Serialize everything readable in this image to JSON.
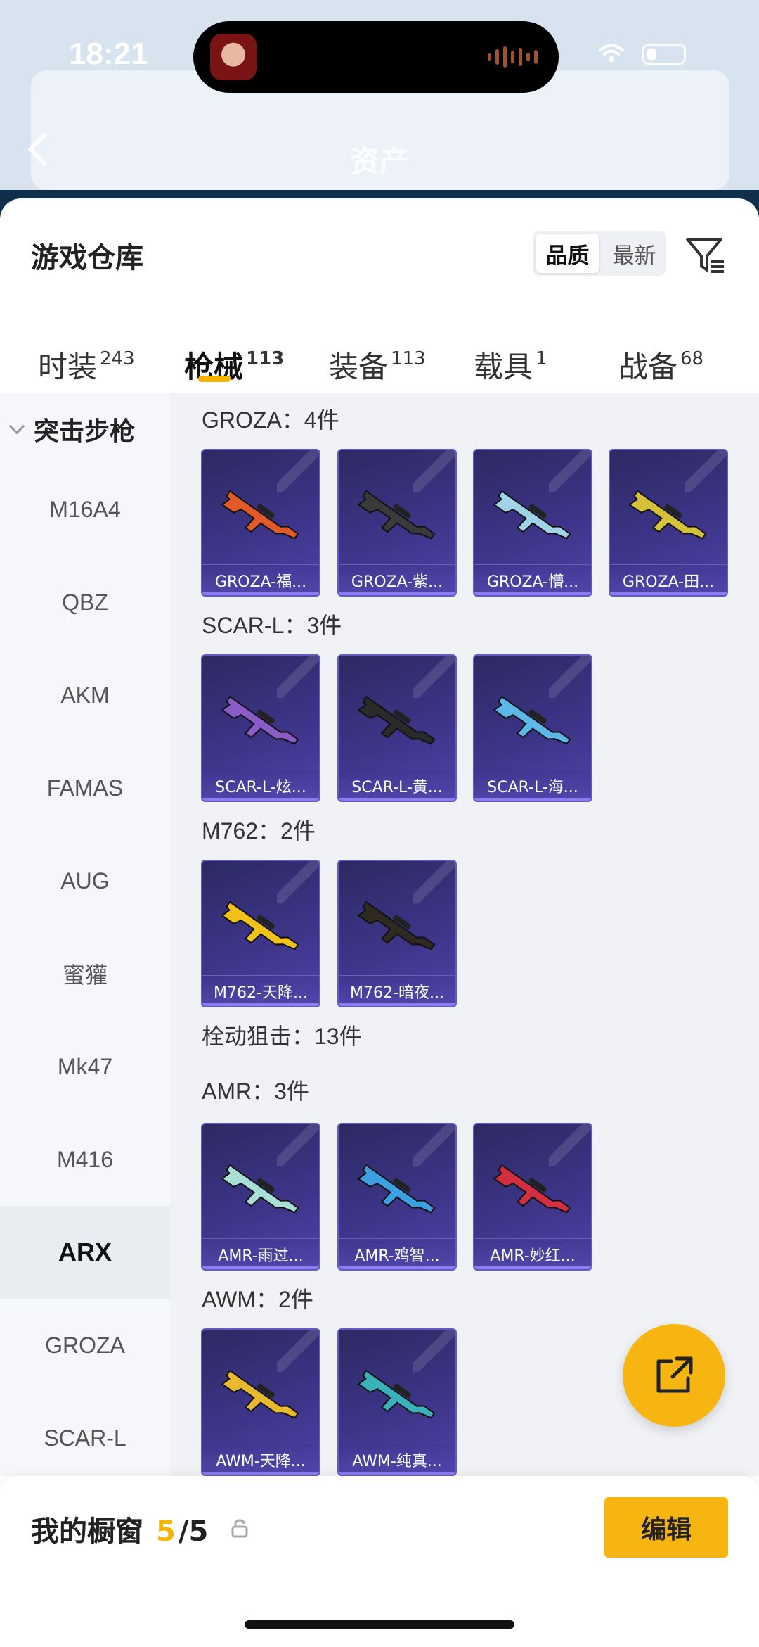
{
  "status_bar": {
    "time": "18:21"
  },
  "background_screen": {
    "title": "资产"
  },
  "sheet": {
    "title": "游戏仓库",
    "sort": {
      "options": [
        "品质",
        "最新"
      ],
      "selected": "品质"
    },
    "tabs": [
      {
        "label": "时装",
        "count": "243"
      },
      {
        "label": "枪械",
        "count": "113",
        "active": true
      },
      {
        "label": "装备",
        "count": "113"
      },
      {
        "label": "载具",
        "count": "1"
      },
      {
        "label": "战备",
        "count": "68"
      }
    ]
  },
  "sidebar": {
    "group": "突击步枪",
    "items": [
      "M16A4",
      "QBZ",
      "AKM",
      "FAMAS",
      "AUG",
      "蜜獾",
      "Mk47",
      "M416",
      "ARX",
      "GROZA",
      "SCAR-L"
    ],
    "selected": "ARX"
  },
  "sections": [
    {
      "title": "GROZA：4件",
      "items": [
        "GROZA-福...",
        "GROZA-紫...",
        "GROZA-懵...",
        "GROZA-田..."
      ]
    },
    {
      "title": "SCAR-L：3件",
      "items": [
        "SCAR-L-炫...",
        "SCAR-L-黄...",
        "SCAR-L-海..."
      ]
    },
    {
      "title": "M762：2件",
      "items": [
        "M762-天降...",
        "M762-暗夜..."
      ]
    },
    {
      "title": "栓动狙击：13件",
      "items": []
    },
    {
      "title": "AMR：3件",
      "items": [
        "AMR-雨过...",
        "AMR-鸡智...",
        "AMR-妙红..."
      ]
    },
    {
      "title": "AWM：2件",
      "items": [
        "AWM-天降...",
        "AWM-纯真..."
      ]
    }
  ],
  "gun_colors": [
    "#e25a2a",
    "#3a3a3a",
    "#9ed3e8",
    "#d6c23a",
    "#8a5cc8",
    "#2a2a2a",
    "#5bb8e8",
    "#f2c21a",
    "#2e2a22",
    "#a8e0d8",
    "#3aa0e0",
    "#d23040",
    "#e8b830",
    "#3ab0b8"
  ],
  "showcase": {
    "label": "我的橱窗",
    "current": "5",
    "total": "/5",
    "edit_label": "编辑"
  },
  "icons": {
    "filter": "filter-icon",
    "share": "share-icon",
    "lock": "lock-icon"
  }
}
